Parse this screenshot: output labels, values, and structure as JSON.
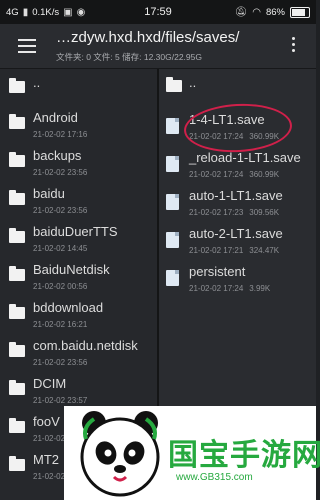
{
  "status": {
    "network": "4G",
    "speed": "0.1K/s",
    "time": "17:59",
    "battery": "86%"
  },
  "toolbar": {
    "path": "…zdyw.hxd.hxd/files/saves/",
    "info": "文件夹: 0  文件: 5  储存: 12.30G/22.95G"
  },
  "left_pane": {
    "updir": "..",
    "items": [
      {
        "name": "Android",
        "date": "21-02-02 17:16"
      },
      {
        "name": "backups",
        "date": "21-02-02 23:56"
      },
      {
        "name": "baidu",
        "date": "21-02-02 23:56"
      },
      {
        "name": "baiduDuerTTS",
        "date": "21-02-02 14:45"
      },
      {
        "name": "BaiduNetdisk",
        "date": "21-02-02 00:56"
      },
      {
        "name": "bddownload",
        "date": "21-02-02 16:21"
      },
      {
        "name": "com.baidu.netdisk",
        "date": "21-02-02 23:56"
      },
      {
        "name": "DCIM",
        "date": "21-02-02 23:57"
      },
      {
        "name": "fooV",
        "date": "21-02-02"
      },
      {
        "name": "MT2",
        "date": "21-02-02"
      }
    ]
  },
  "right_pane": {
    "updir": "..",
    "items": [
      {
        "name": "1-4-LT1.save",
        "date": "21-02-02 17:24",
        "size": "360.99K"
      },
      {
        "name": "_reload-1-LT1.save",
        "date": "21-02-02 17:24",
        "size": "360.99K"
      },
      {
        "name": "auto-1-LT1.save",
        "date": "21-02-02 17:23",
        "size": "309.56K"
      },
      {
        "name": "auto-2-LT1.save",
        "date": "21-02-02 17:21",
        "size": "324.47K"
      },
      {
        "name": "persistent",
        "date": "21-02-02 17:24",
        "size": "3.99K"
      }
    ]
  },
  "watermark": {
    "title": "国宝手游网",
    "url": "www.GB315.com"
  }
}
